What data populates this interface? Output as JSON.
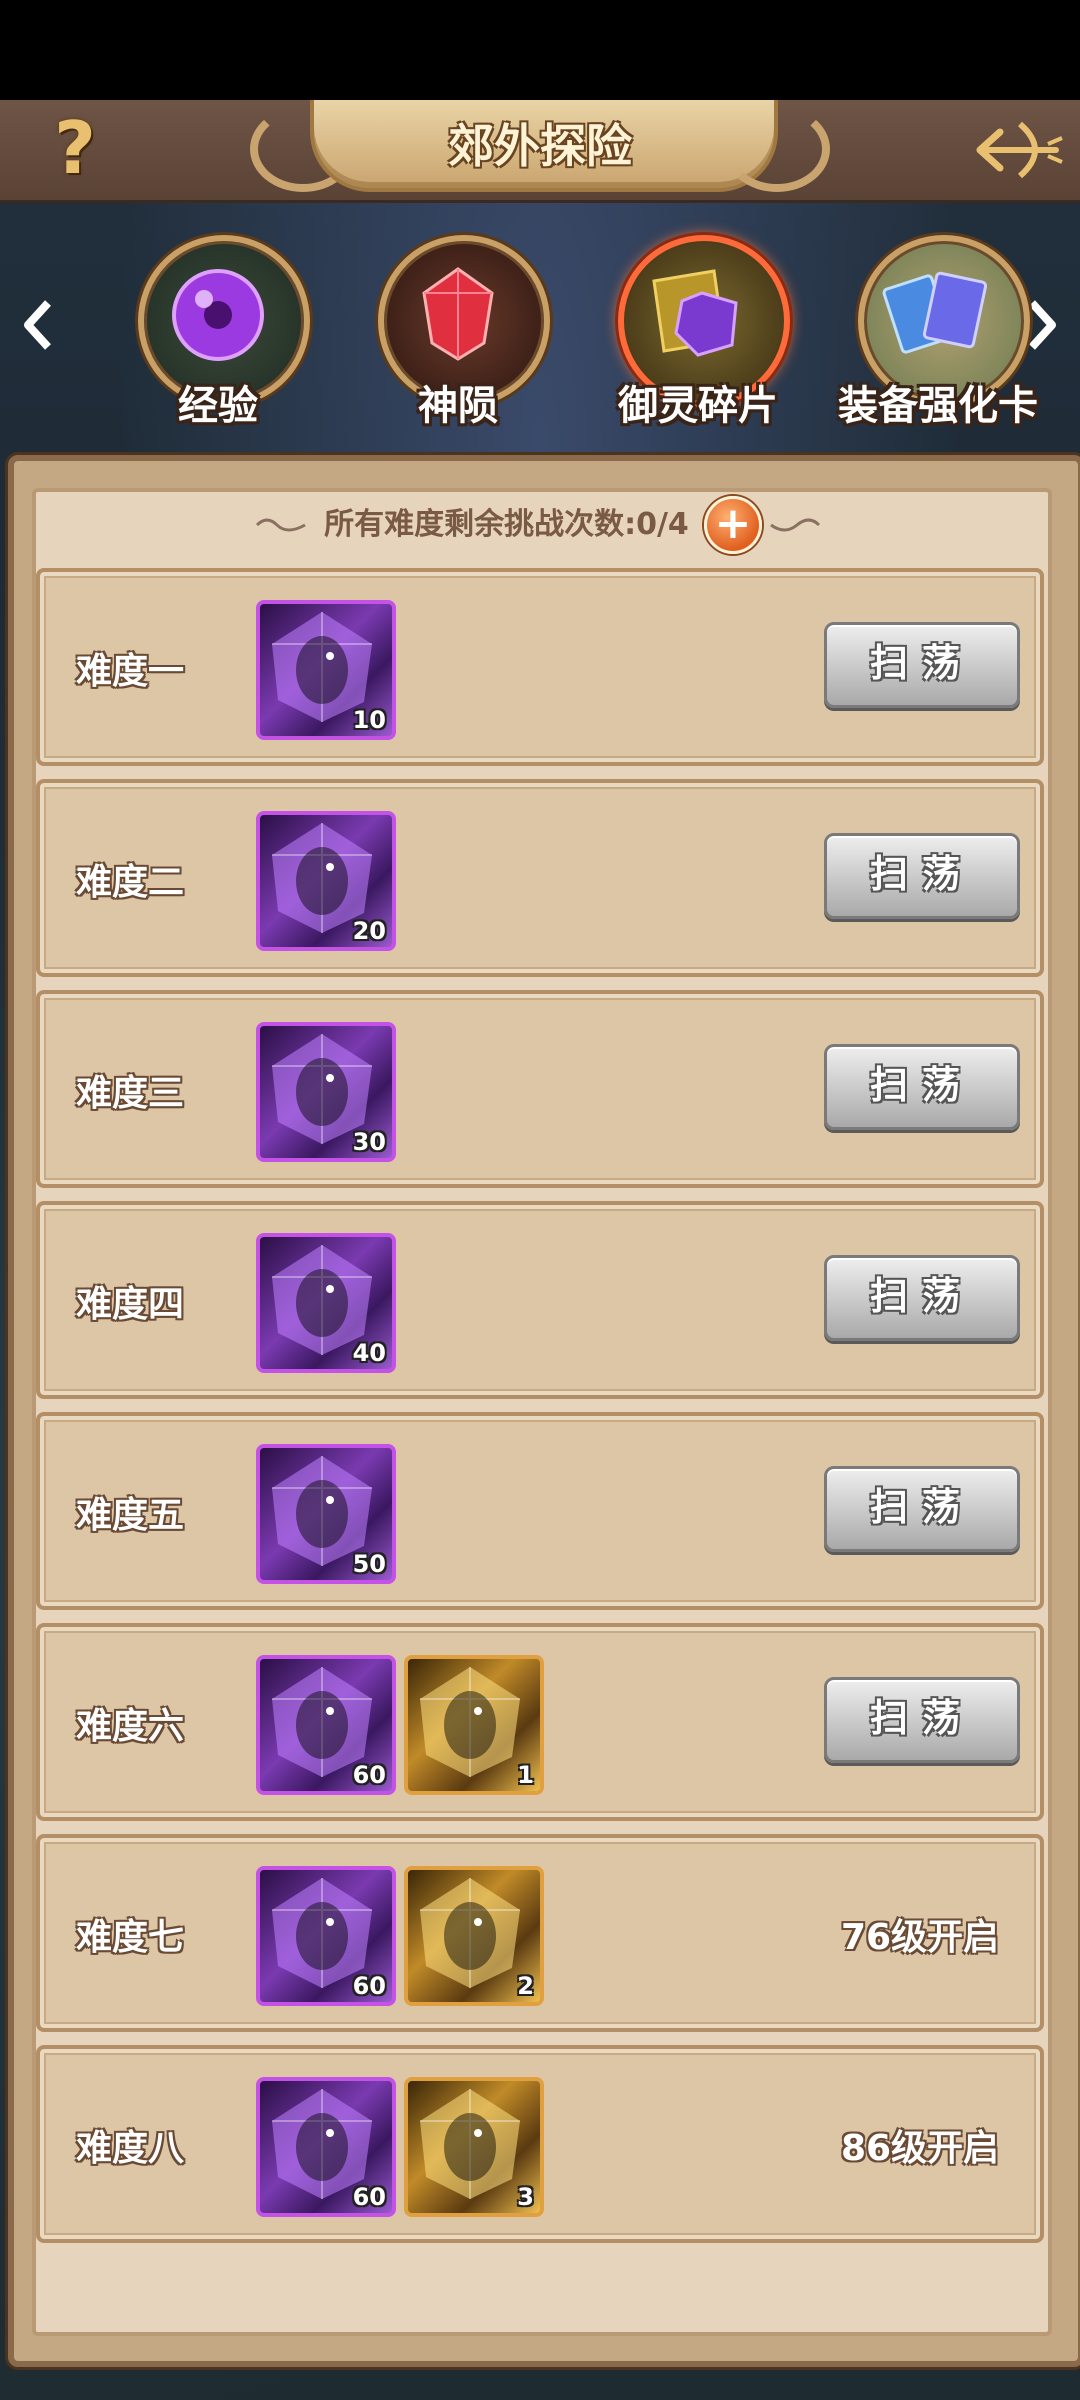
{
  "header": {
    "title": "郊外探险",
    "help_label": "?",
    "back_icon": "bow-arrow-back-icon"
  },
  "categories": [
    {
      "label": "经验",
      "icon": "purple-orb-icon"
    },
    {
      "label": "神陨",
      "icon": "red-gem-icon"
    },
    {
      "label": "御灵碎片",
      "icon": "spirit-shard-icon",
      "active": true
    },
    {
      "label": "装备强化卡",
      "icon": "enhance-card-icon"
    }
  ],
  "remaining": {
    "text": "所有难度剩余挑战次数:0/4",
    "plus_label": "+"
  },
  "levels": [
    {
      "name": "难度一",
      "rewards": [
        {
          "type": "purple",
          "count": "10"
        }
      ],
      "action": "扫荡"
    },
    {
      "name": "难度二",
      "rewards": [
        {
          "type": "purple",
          "count": "20"
        }
      ],
      "action": "扫荡"
    },
    {
      "name": "难度三",
      "rewards": [
        {
          "type": "purple",
          "count": "30"
        }
      ],
      "action": "扫荡"
    },
    {
      "name": "难度四",
      "rewards": [
        {
          "type": "purple",
          "count": "40"
        }
      ],
      "action": "扫荡"
    },
    {
      "name": "难度五",
      "rewards": [
        {
          "type": "purple",
          "count": "50"
        }
      ],
      "action": "扫荡"
    },
    {
      "name": "难度六",
      "rewards": [
        {
          "type": "purple",
          "count": "60"
        },
        {
          "type": "gold",
          "count": "1"
        }
      ],
      "action": "扫荡"
    },
    {
      "name": "难度七",
      "rewards": [
        {
          "type": "purple",
          "count": "60"
        },
        {
          "type": "gold",
          "count": "2"
        }
      ],
      "locked": "76级开启"
    },
    {
      "name": "难度八",
      "rewards": [
        {
          "type": "purple",
          "count": "60"
        },
        {
          "type": "gold",
          "count": "3"
        }
      ],
      "locked": "86级开启"
    }
  ],
  "colors": {
    "header_bg": "#6e5546",
    "panel_bg": "#e6d5bc",
    "row_bg": "#dcc6a6",
    "purple_frame": "#c452e6",
    "gold_frame": "#e0a040",
    "active_ring": "#ff6a3a"
  }
}
